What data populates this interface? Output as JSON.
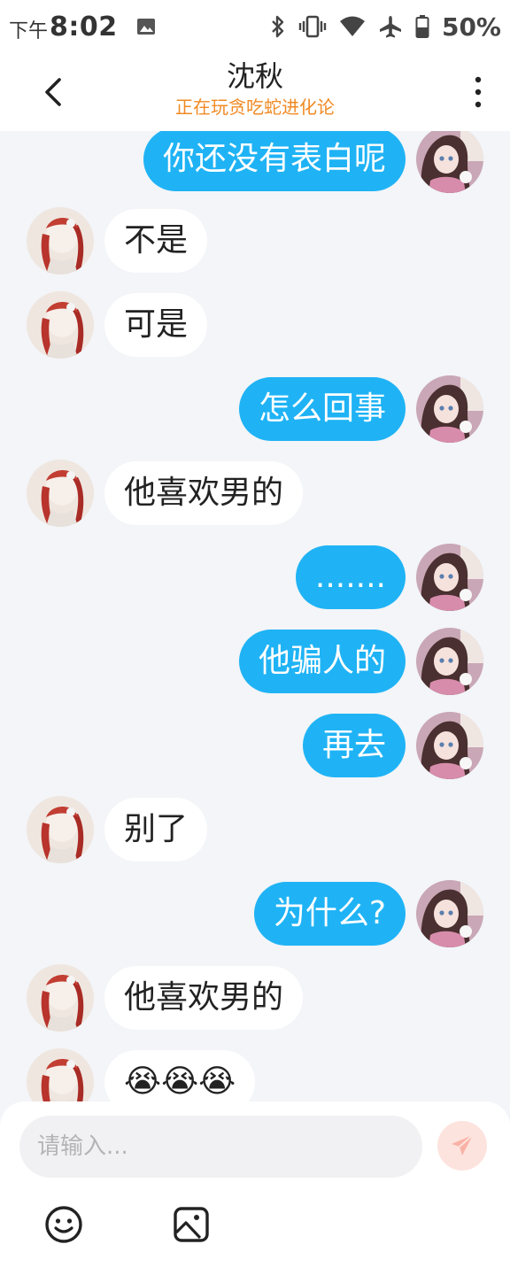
{
  "status_bar": {
    "ampm": "下午",
    "time": "8:02",
    "battery": "50%"
  },
  "header": {
    "title": "沈秋",
    "subtitle": "正在玩贪吃蛇进化论"
  },
  "messages": [
    {
      "side": "right",
      "text": "你还没有表白呢"
    },
    {
      "side": "left",
      "text": "不是"
    },
    {
      "side": "left",
      "text": "可是"
    },
    {
      "side": "right",
      "text": "怎么回事"
    },
    {
      "side": "left",
      "text": "他喜欢男的"
    },
    {
      "side": "right",
      "text": "......."
    },
    {
      "side": "right",
      "text": "他骗人的"
    },
    {
      "side": "right",
      "text": "再去"
    },
    {
      "side": "left",
      "text": "别了"
    },
    {
      "side": "right",
      "text": "为什么?"
    },
    {
      "side": "left",
      "text": "他喜欢男的"
    },
    {
      "side": "left",
      "text": "😭😭😭"
    }
  ],
  "input": {
    "placeholder": "请输入..."
  },
  "icons": {
    "back": "back-icon",
    "more": "more-icon",
    "send": "send-icon",
    "emoji": "emoji-icon",
    "image": "image-icon"
  },
  "colors": {
    "accent": "#1fb3f5",
    "subtitle": "#f08a24",
    "send_bg": "#fde3de",
    "send_icon": "#f9b2a6",
    "background": "#f3f5f8"
  }
}
